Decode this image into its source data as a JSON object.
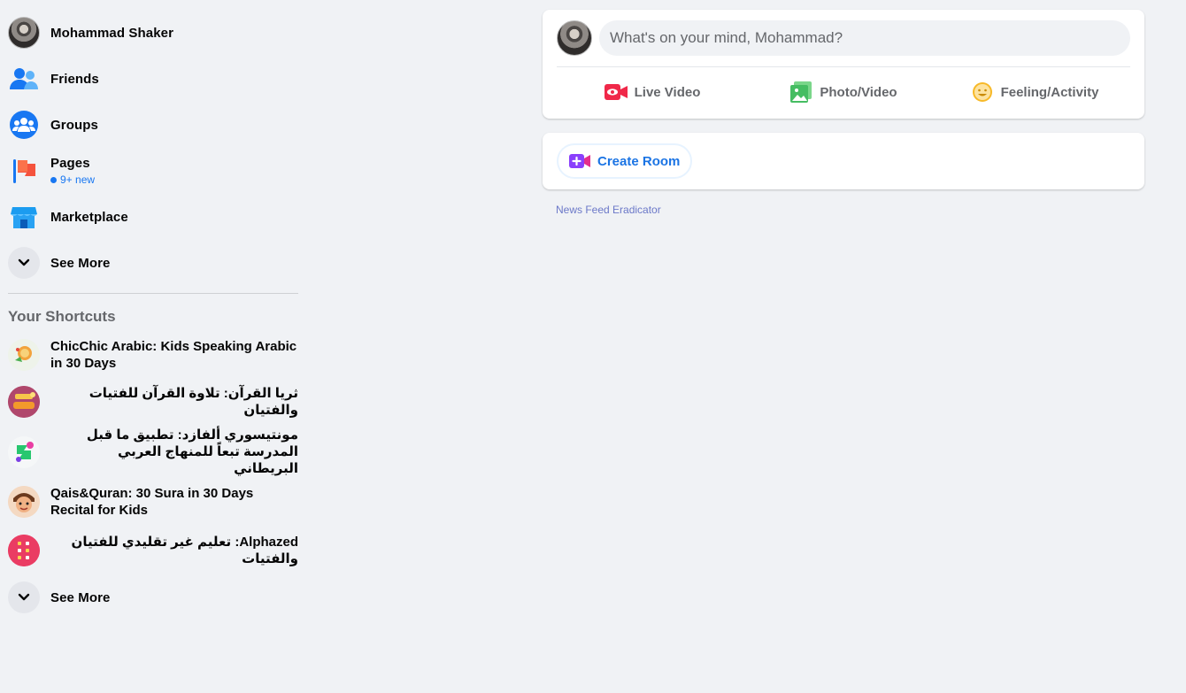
{
  "sidebar": {
    "profile": {
      "name": "Mohammad Shaker"
    },
    "items": [
      {
        "label": "Friends",
        "icon": "friends-icon"
      },
      {
        "label": "Groups",
        "icon": "groups-icon"
      },
      {
        "label": "Pages",
        "icon": "pages-icon",
        "badge": "9+ new"
      },
      {
        "label": "Marketplace",
        "icon": "marketplace-icon"
      }
    ],
    "see_more": "See More",
    "shortcuts_title": "Your Shortcuts",
    "shortcuts": [
      {
        "label": "ChicChic Arabic: Kids Speaking Arabic in 30 Days",
        "rtl": false
      },
      {
        "label": "ثريا القرآن: تلاوة القرآن للفتيات والفتيان",
        "rtl": true
      },
      {
        "label": "مونتيسوري ألفازد: تطبيق ما قبل المدرسة تبعاً للمنهاج العربي البريطاني",
        "rtl": true
      },
      {
        "label": "Qais&Quran: 30 Sura in 30 Days Recital for Kids",
        "rtl": false
      },
      {
        "label": "Alphazed: تعليم غير تقليدي للفتيان والفتيات",
        "rtl": true
      }
    ],
    "shortcuts_see_more": "See More"
  },
  "composer": {
    "placeholder": "What's on your mind, Mohammad?",
    "actions": [
      {
        "label": "Live Video",
        "icon": "live-video-icon",
        "color": "#f02849"
      },
      {
        "label": "Photo/Video",
        "icon": "photo-video-icon",
        "color": "#45bd62"
      },
      {
        "label": "Feeling/Activity",
        "icon": "feeling-icon",
        "color": "#f7b928"
      }
    ]
  },
  "rooms": {
    "create_label": "Create Room"
  },
  "footer_link": "News Feed Eradicator"
}
